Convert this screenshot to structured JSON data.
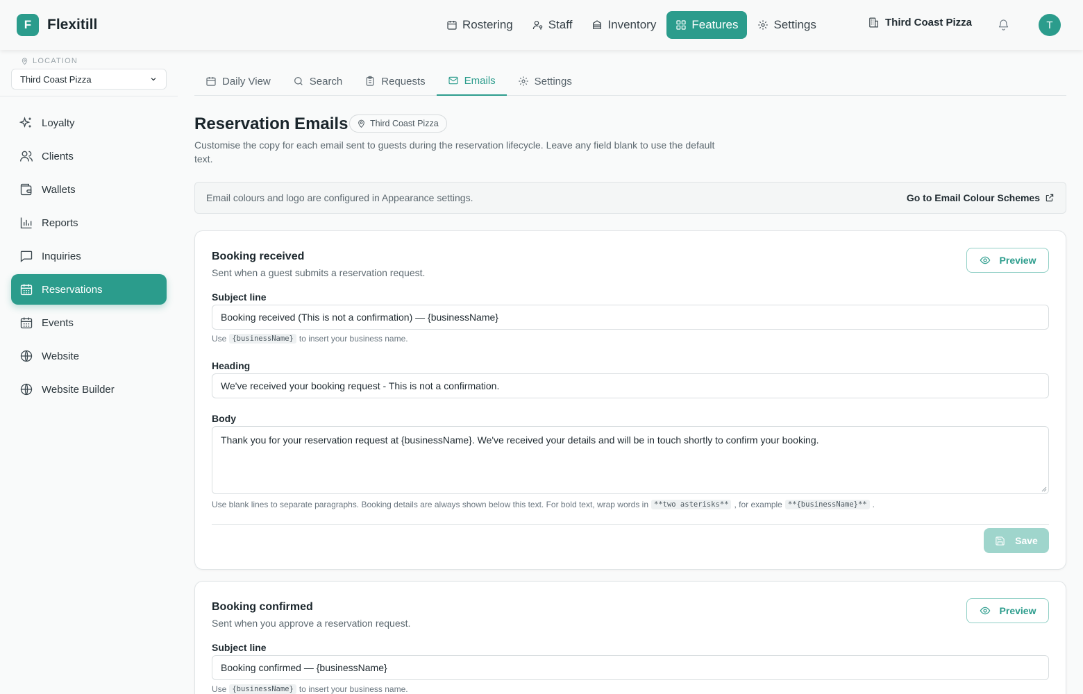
{
  "app": {
    "logo_letter": "F",
    "name": "Flexitill",
    "accent_color": "#2b9c8c"
  },
  "topnav": {
    "items": [
      {
        "label": "Rostering",
        "icon": "calendar-icon"
      },
      {
        "label": "Staff",
        "icon": "user-key-icon"
      },
      {
        "label": "Inventory",
        "icon": "archive-icon"
      },
      {
        "label": "Features",
        "icon": "grid-icon",
        "active": true
      },
      {
        "label": "Settings",
        "icon": "gear-icon"
      }
    ],
    "business": "Third Coast Pizza",
    "avatar_letter": "T"
  },
  "sidebar": {
    "location_label": "LOCATION",
    "location_value": "Third Coast Pizza",
    "items": [
      {
        "label": "Loyalty",
        "icon": "sparkles-icon"
      },
      {
        "label": "Clients",
        "icon": "users-icon"
      },
      {
        "label": "Wallets",
        "icon": "wallet-icon"
      },
      {
        "label": "Reports",
        "icon": "bar-chart-icon"
      },
      {
        "label": "Inquiries",
        "icon": "message-square-icon"
      },
      {
        "label": "Reservations",
        "icon": "calendar-grid-icon",
        "active": true
      },
      {
        "label": "Events",
        "icon": "calendar-grid-icon"
      },
      {
        "label": "Website",
        "icon": "globe-icon"
      },
      {
        "label": "Website Builder",
        "icon": "globe-icon"
      }
    ]
  },
  "subtabs": [
    {
      "label": "Daily View",
      "icon": "calendar-icon"
    },
    {
      "label": "Search",
      "icon": "search-icon"
    },
    {
      "label": "Requests",
      "icon": "clipboard-icon"
    },
    {
      "label": "Emails",
      "icon": "mail-icon",
      "active": true
    },
    {
      "label": "Settings",
      "icon": "gear-icon"
    }
  ],
  "page": {
    "title": "Reservation Emails",
    "badge": "Third Coast Pizza",
    "description": "Customise the copy for each email sent to guests during the reservation lifecycle. Leave any field blank to use the default text."
  },
  "info_bar": {
    "text": "Email colours and logo are configured in Appearance settings.",
    "link": "Go to Email Colour Schemes"
  },
  "cards": [
    {
      "title": "Booking received",
      "subtitle": "Sent when a guest submits a reservation request.",
      "preview_label": "Preview",
      "subject_label": "Subject line",
      "subject_value": "Booking received (This is not a confirmation) — {businessName}",
      "subject_hint_pre": "Use",
      "subject_hint_code": "{businessName}",
      "subject_hint_post": "to insert your business name.",
      "heading_label": "Heading",
      "heading_value": "We've received your booking request - This is not a confirmation.",
      "body_label": "Body",
      "body_value": "Thank you for your reservation request at {businessName}. We've received your details and will be in touch shortly to confirm your booking.",
      "body_hint_pre": "Use blank lines to separate paragraphs. Booking details are always shown below this text. For bold text, wrap words in",
      "body_hint_code1": "**two asterisks**",
      "body_hint_mid": ", for example",
      "body_hint_code2": "**{businessName}**",
      "body_hint_post": ".",
      "save_label": "Save"
    },
    {
      "title": "Booking confirmed",
      "subtitle": "Sent when you approve a reservation request.",
      "preview_label": "Preview",
      "subject_label": "Subject line",
      "subject_value": "Booking confirmed — {businessName}",
      "subject_hint_pre": "Use",
      "subject_hint_code": "{businessName}",
      "subject_hint_post": "to insert your business name."
    }
  ]
}
